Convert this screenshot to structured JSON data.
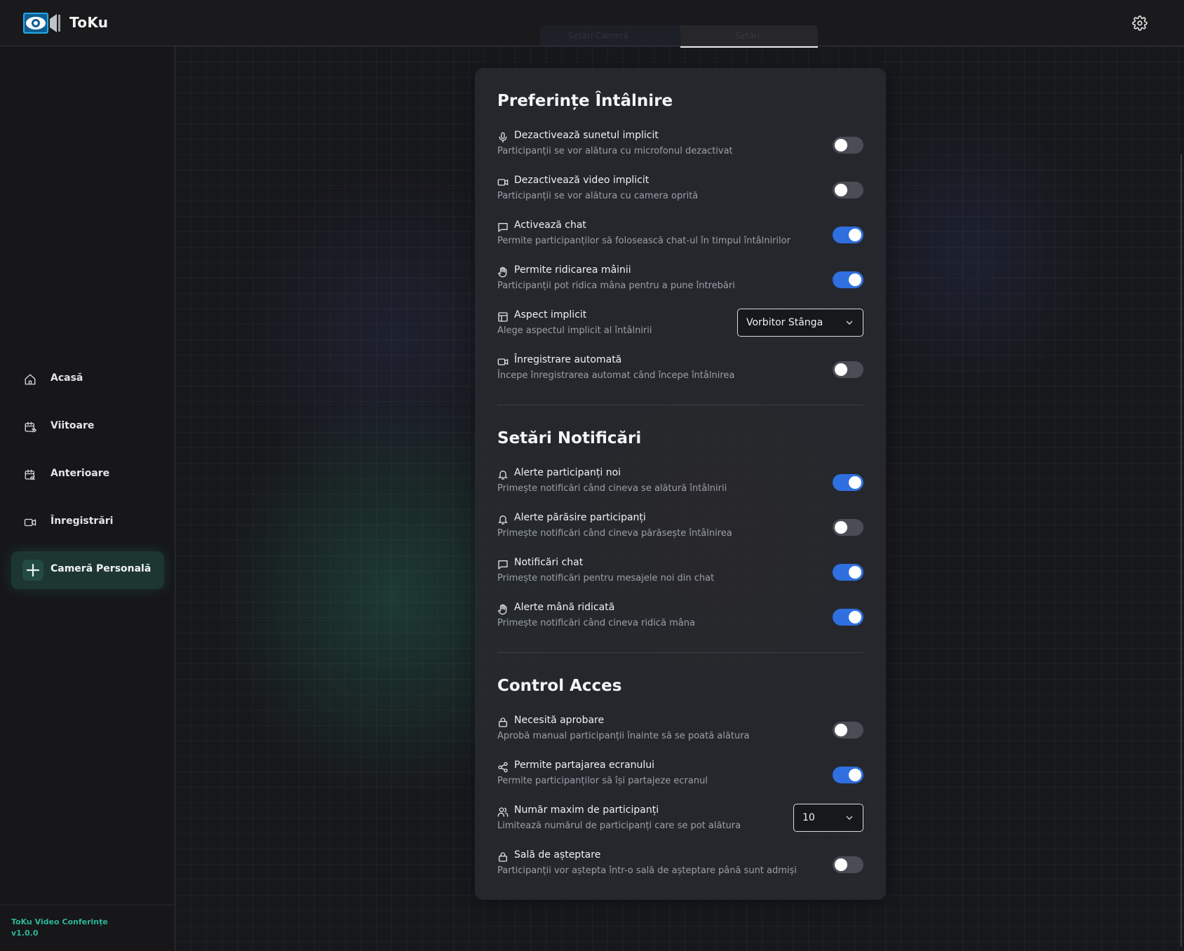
{
  "app": {
    "name": "ToKu"
  },
  "top_tabs": [
    {
      "label": "Setări Cameră"
    },
    {
      "label": "Setări"
    }
  ],
  "sidebar": {
    "items": [
      {
        "label": "Acasă",
        "icon": "home-icon"
      },
      {
        "label": "Viitoare",
        "icon": "calendar-forward-icon"
      },
      {
        "label": "Anterioare",
        "icon": "calendar-back-icon"
      },
      {
        "label": "Înregistrări",
        "icon": "video-icon"
      }
    ],
    "personal_room": {
      "label": "Cameră Personală",
      "icon": "plus-icon"
    },
    "footer": {
      "line1": "ToKu Video Conferințe",
      "line2": "v1.0.0"
    }
  },
  "sections": {
    "meeting": {
      "title": "Preferințe Întâlnire",
      "rows": [
        {
          "title": "Dezactivează sunetul implicit",
          "desc": "Participanții se vor alătura cu microfonul dezactivat",
          "icon": "microphone-icon",
          "on": false
        },
        {
          "title": "Dezactivează video implicit",
          "desc": "Participanții se vor alătura cu camera oprită",
          "icon": "video-icon",
          "on": false
        },
        {
          "title": "Activează chat",
          "desc": "Permite participanților să folosească chat-ul în timpul întâlnirilor",
          "icon": "chat-icon",
          "on": true
        },
        {
          "title": "Permite ridicarea mâinii",
          "desc": "Participanții pot ridica mâna pentru a pune întrebări",
          "icon": "hand-icon",
          "on": true
        },
        {
          "title": "Aspect implicit",
          "desc": "Alege aspectul implicit al întâlnirii",
          "icon": "layout-icon",
          "select": "Vorbitor Stânga"
        },
        {
          "title": "Înregistrare automată",
          "desc": "Începe înregistrarea automat când începe întâlnirea",
          "icon": "video-icon",
          "on": false
        }
      ]
    },
    "notifications": {
      "title": "Setări Notificări",
      "rows": [
        {
          "title": "Alerte participanți noi",
          "desc": "Primește notificări când cineva se alătură întâlnirii",
          "icon": "bell-icon",
          "on": true
        },
        {
          "title": "Alerte părăsire participanți",
          "desc": "Primește notificări când cineva părăsește întâlnirea",
          "icon": "bell-icon",
          "on": false
        },
        {
          "title": "Notificări chat",
          "desc": "Primește notificări pentru mesajele noi din chat",
          "icon": "chat-icon",
          "on": true
        },
        {
          "title": "Alerte mână ridicată",
          "desc": "Primește notificări când cineva ridică mâna",
          "icon": "hand-icon",
          "on": true
        }
      ]
    },
    "access": {
      "title": "Control Acces",
      "rows": [
        {
          "title": "Necesită aprobare",
          "desc": "Aprobă manual participanții înainte să se poată alătura",
          "icon": "lock-icon",
          "on": false
        },
        {
          "title": "Permite partajarea ecranului",
          "desc": "Permite participanților să își partajeze ecranul",
          "icon": "share-icon",
          "on": true
        },
        {
          "title": "Număr maxim de participanți",
          "desc": "Limitează numărul de participanți care se pot alătura",
          "icon": "users-icon",
          "select": "10"
        },
        {
          "title": "Sală de așteptare",
          "desc": "Participanții vor aștepta într-o sală de așteptare până sunt admiși",
          "icon": "lock-icon",
          "on": false
        }
      ]
    }
  },
  "colors": {
    "accent": "#2f6fe0",
    "brand_green": "#2bb59a",
    "toggle_off": "#4a4d55"
  }
}
